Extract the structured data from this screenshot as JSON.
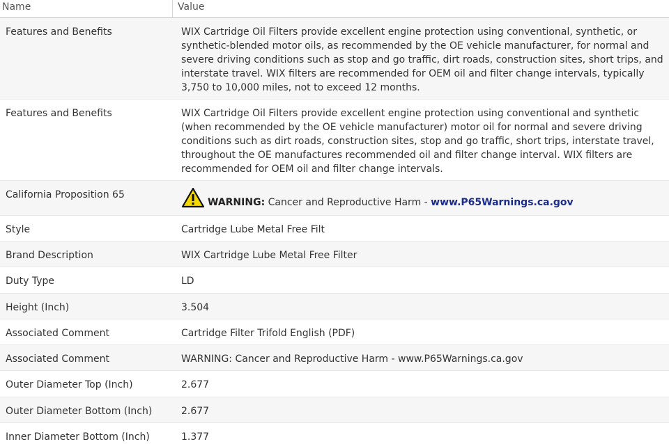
{
  "table": {
    "headers": {
      "name": "Name",
      "value": "Value"
    },
    "rows": [
      {
        "name": "Features and Benefits",
        "value": "WIX Cartridge Oil Filters provide excellent engine protection using conventional, synthetic, or synthetic-blended motor oils, as recommended by the OE vehicle manufacturer, for normal and severe driving conditions such as stop and go traffic, dirt roads, construction sites, short trips, and interstate travel. WIX filters are recommended for OEM oil and filter change intervals, typically 3,750 to 10,000 miles, not to exceed 12 months."
      },
      {
        "name": "Features and Benefits",
        "value": "WIX Cartridge Oil Filters provide excellent engine protection using conventional and synthetic (when recommended by the OE vehicle manufacturer) motor oil for normal and severe driving conditions such as dirt roads, construction sites, stop and go traffic, short trips, interstate travel, throughout the OE manufactures recommended oil and filter change interval. WIX filters are recommended for OEM oil and filter change intervals."
      },
      {
        "name": "California Proposition 65",
        "warning_label": "WARNING:",
        "warning_text": " Cancer and Reproductive Harm - ",
        "warning_link": "www.P65Warnings.ca.gov"
      },
      {
        "name": "Style",
        "value": "Cartridge Lube Metal Free Filt"
      },
      {
        "name": "Brand Description",
        "value": "WIX Cartridge Lube Metal Free Filter"
      },
      {
        "name": "Duty Type",
        "value": "LD"
      },
      {
        "name": "Height (Inch)",
        "value": "3.504"
      },
      {
        "name": "Associated Comment",
        "value": "Cartridge Filter Trifold English (PDF)"
      },
      {
        "name": "Associated Comment",
        "value": "WARNING: Cancer and Reproductive Harm - www.P65Warnings.ca.gov"
      },
      {
        "name": "Outer Diameter Top (Inch)",
        "value": "2.677"
      },
      {
        "name": "Outer Diameter Bottom (Inch)",
        "value": "2.677"
      },
      {
        "name": "Inner Diameter Bottom (Inch)",
        "value": "1.377"
      }
    ]
  },
  "colors": {
    "link": "#1c2c8c",
    "warning_yellow": "#f5d800",
    "stripe": "#f6f6f6"
  },
  "icons": {
    "warning": "warning-triangle-icon"
  }
}
